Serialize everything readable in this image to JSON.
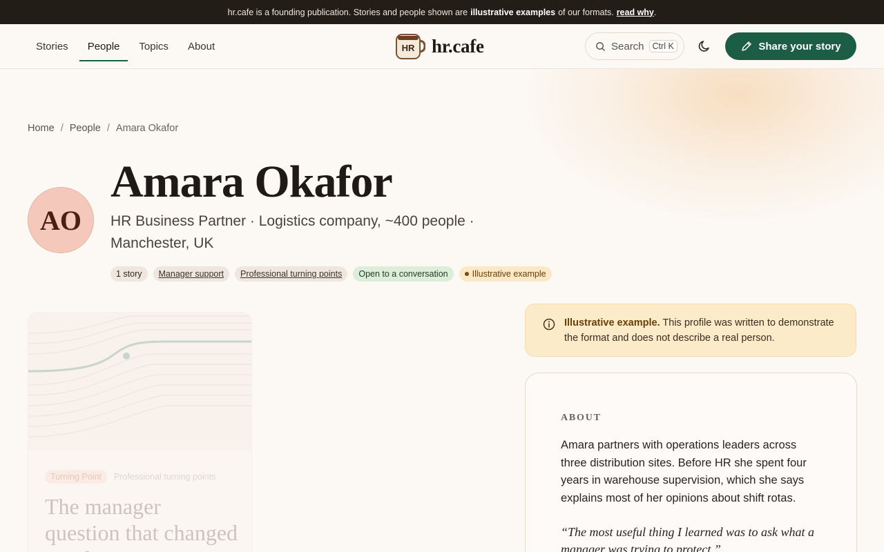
{
  "banner": {
    "text_before": "hr.cafe is a founding publication. Stories and people shown are",
    "text_bold": "illustrative examples",
    "text_after": "of our formats.",
    "link": "read why",
    "period": "."
  },
  "nav": {
    "items": [
      {
        "label": "Stories"
      },
      {
        "label": "People"
      },
      {
        "label": "Topics"
      },
      {
        "label": "About"
      }
    ],
    "active": "People"
  },
  "logo": {
    "badge": "HR",
    "text": "hr.cafe"
  },
  "search": {
    "label": "Search",
    "shortcut": "Ctrl K"
  },
  "share_button": {
    "label": "Share your story"
  },
  "breadcrumb": [
    "Home",
    "People",
    "Amara Okafor"
  ],
  "profile": {
    "initials": "AO",
    "name": "Amara Okafor",
    "subtitle": "HR Business Partner · Logistics company, ~400 people · Manchester, UK",
    "chips": {
      "count": "1 story",
      "topic1": "Manager support",
      "topic2": "Professional turning points",
      "status": "Open to a conversation",
      "example": "Illustrative example"
    }
  },
  "story_card": {
    "tag": "Turning Point",
    "topic": "Professional turning points",
    "title": "The manager question that changed minds"
  },
  "notice": {
    "bold": "Illustrative example.",
    "text": "This profile was written to demonstrate the format and does not describe a real person."
  },
  "about": {
    "label": "ABOUT",
    "body": "Amara partners with operations leaders across three distribution sites. Before HR she spent four years in warehouse supervision, which she says explains most of her opinions about shift rotas.",
    "quote": "“The most useful thing I learned was to ask what a manager was trying to protect.”"
  },
  "colors": {
    "accent": "#1b5e45",
    "banner_bg": "#231d18",
    "page_bg": "#fcf8f4",
    "notice_bg": "#fcebc9"
  }
}
